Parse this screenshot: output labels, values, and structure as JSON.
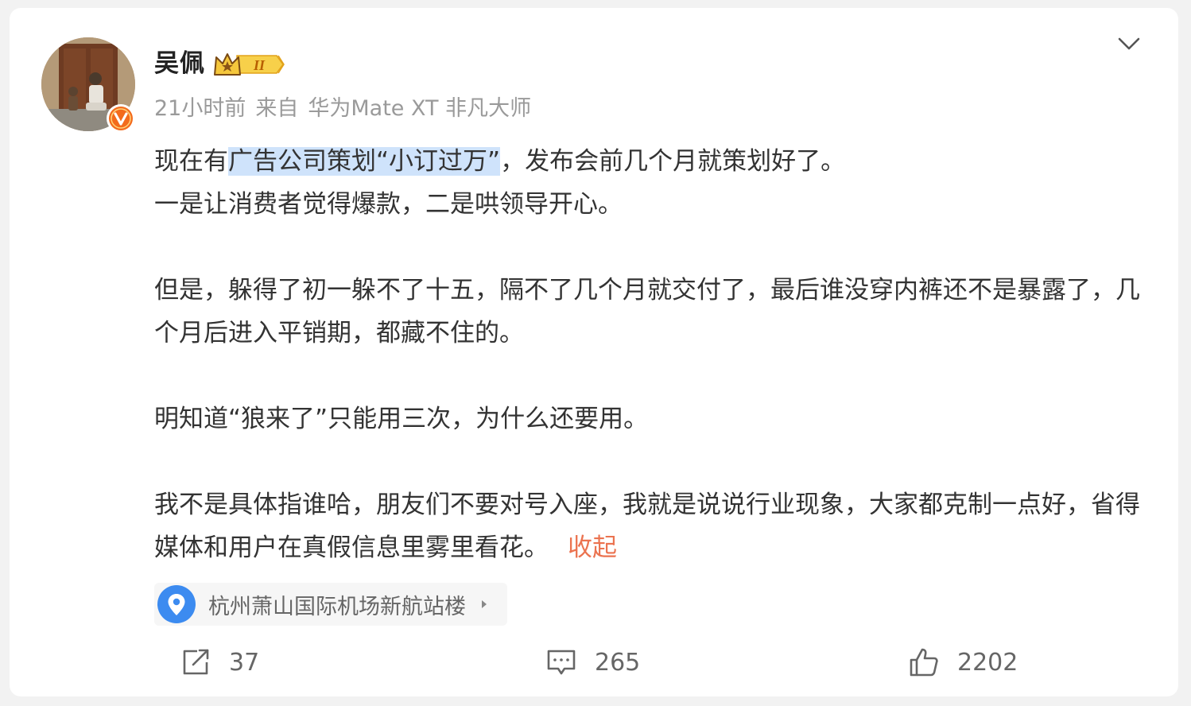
{
  "post": {
    "author": "吴佩",
    "rank_badge_roman": "II",
    "time": "21小时前",
    "source_prefix": "来自",
    "source_device": "华为Mate XT 非凡大师",
    "paragraphs": {
      "p1": {
        "before": "现在有",
        "highlight": "广告公司策划“小订过万”",
        "after": "，发布会前几个月就策划好了。"
      },
      "p2": "一是让消费者觉得爆款，二是哄领导开心。",
      "p3": "但是，躲得了初一躲不了十五，隔不了几个月就交付了，最后谁没穿内裤还不是暴露了，几个月后进入平销期，都藏不住的。",
      "p4": "明知道“狼来了”只能用三次，为什么还要用。",
      "p5": "我不是具体指谁哈，朋友们不要对号入座，我就是说说行业现象，大家都克制一点好，省得媒体和用户在真假信息里雾里看花。"
    },
    "collapse_label": "收起",
    "location": "杭州萧山国际机场新航站楼",
    "actions": {
      "repost_count": "37",
      "comment_count": "265",
      "like_count": "2202"
    }
  },
  "colors": {
    "accent_link": "#eb7350",
    "highlight": "#cfe3fb",
    "location_pin": "#3c8bf0",
    "verified_badge": "#f36b1c"
  },
  "icons": {
    "verified": "verified-v-icon",
    "rank": "crown-rank-icon",
    "menu": "chevron-down-icon",
    "location": "location-pin-icon",
    "repost": "repost-icon",
    "comment": "comment-icon",
    "like": "thumbs-up-icon"
  }
}
